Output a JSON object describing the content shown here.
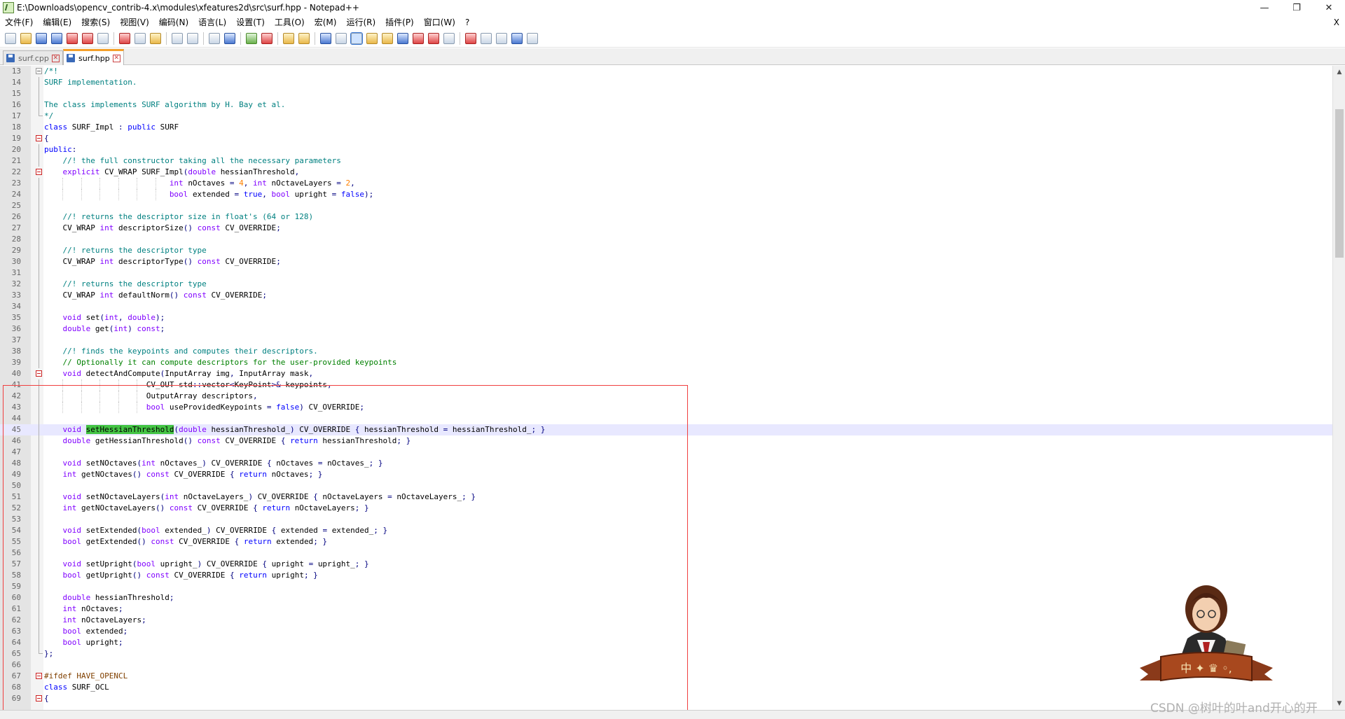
{
  "window": {
    "title": "E:\\Downloads\\opencv_contrib-4.x\\modules\\xfeatures2d\\src\\surf.hpp - Notepad++",
    "minimize": "—",
    "maximize": "❐",
    "close": "✕"
  },
  "menu": {
    "items": [
      "文件(F)",
      "编辑(E)",
      "搜索(S)",
      "视图(V)",
      "编码(N)",
      "语言(L)",
      "设置(T)",
      "工具(O)",
      "宏(M)",
      "运行(R)",
      "插件(P)",
      "窗口(W)",
      "?"
    ],
    "close_doc": "X"
  },
  "tabs": [
    {
      "label": "surf.cpp",
      "active": false
    },
    {
      "label": "surf.hpp",
      "active": true
    }
  ],
  "code": {
    "first_line": 13,
    "current_line": 45,
    "lines": [
      [
        [
          "",
          "/*!",
          "cm"
        ]
      ],
      [
        [
          "",
          "SURF implementation.",
          "cm"
        ]
      ],
      [
        [
          "",
          ""
        ]
      ],
      [
        [
          "",
          "The class implements SURF algorithm by H. Bay et al.",
          "cm"
        ]
      ],
      [
        [
          "",
          "*/",
          "cm"
        ]
      ],
      [
        [
          "",
          "class ",
          "kw"
        ],
        [
          "",
          "SURF_Impl "
        ],
        [
          "",
          ": ",
          "op"
        ],
        [
          "",
          "public ",
          "kw"
        ],
        [
          "",
          "SURF"
        ]
      ],
      [
        [
          "",
          "{",
          "op"
        ]
      ],
      [
        [
          "",
          "public",
          "kw"
        ],
        [
          "",
          ":",
          "op"
        ]
      ],
      [
        [
          "    ",
          ""
        ],
        [
          "",
          "//! the full constructor taking all the necessary parameters",
          "cm"
        ]
      ],
      [
        [
          "    ",
          ""
        ],
        [
          "",
          "explicit ",
          "kw2"
        ],
        [
          "",
          "CV_WRAP SURF_Impl"
        ],
        [
          "",
          "(",
          "op"
        ],
        [
          "",
          "double ",
          "kw2"
        ],
        [
          "",
          "hessianThreshold"
        ],
        [
          "",
          ",",
          "op"
        ]
      ],
      [
        [
          "                           ",
          ""
        ],
        [
          "",
          "int ",
          "kw2"
        ],
        [
          "",
          "nOctaves "
        ],
        [
          "",
          "= ",
          "op"
        ],
        [
          "",
          "4",
          "num"
        ],
        [
          "",
          ", ",
          "op"
        ],
        [
          "",
          "int ",
          "kw2"
        ],
        [
          "",
          "nOctaveLayers "
        ],
        [
          "",
          "= ",
          "op"
        ],
        [
          "",
          "2",
          "num"
        ],
        [
          "",
          ",",
          "op"
        ]
      ],
      [
        [
          "                           ",
          ""
        ],
        [
          "",
          "bool ",
          "kw2"
        ],
        [
          "",
          "extended "
        ],
        [
          "",
          "= ",
          "op"
        ],
        [
          "",
          "true",
          "kw"
        ],
        [
          "",
          ", ",
          "op"
        ],
        [
          "",
          "bool ",
          "kw2"
        ],
        [
          "",
          "upright "
        ],
        [
          "",
          "= ",
          "op"
        ],
        [
          "",
          "false",
          "kw"
        ],
        [
          "",
          ");",
          "op"
        ]
      ],
      [
        [
          "",
          ""
        ]
      ],
      [
        [
          "    ",
          ""
        ],
        [
          "",
          "//! returns the descriptor size in float's (64 or 128)",
          "cm"
        ]
      ],
      [
        [
          "    ",
          ""
        ],
        [
          "",
          "CV_WRAP "
        ],
        [
          "",
          "int ",
          "kw2"
        ],
        [
          "",
          "descriptorSize"
        ],
        [
          "",
          "() ",
          "op"
        ],
        [
          "",
          "const ",
          "kw2"
        ],
        [
          "",
          "CV_OVERRIDE"
        ],
        [
          "",
          ";",
          "op"
        ]
      ],
      [
        [
          "",
          ""
        ]
      ],
      [
        [
          "    ",
          ""
        ],
        [
          "",
          "//! returns the descriptor type",
          "cm"
        ]
      ],
      [
        [
          "    ",
          ""
        ],
        [
          "",
          "CV_WRAP "
        ],
        [
          "",
          "int ",
          "kw2"
        ],
        [
          "",
          "descriptorType"
        ],
        [
          "",
          "() ",
          "op"
        ],
        [
          "",
          "const ",
          "kw2"
        ],
        [
          "",
          "CV_OVERRIDE"
        ],
        [
          "",
          ";",
          "op"
        ]
      ],
      [
        [
          "",
          ""
        ]
      ],
      [
        [
          "    ",
          ""
        ],
        [
          "",
          "//! returns the descriptor type",
          "cm"
        ]
      ],
      [
        [
          "    ",
          ""
        ],
        [
          "",
          "CV_WRAP "
        ],
        [
          "",
          "int ",
          "kw2"
        ],
        [
          "",
          "defaultNorm"
        ],
        [
          "",
          "() ",
          "op"
        ],
        [
          "",
          "const ",
          "kw2"
        ],
        [
          "",
          "CV_OVERRIDE"
        ],
        [
          "",
          ";",
          "op"
        ]
      ],
      [
        [
          "",
          ""
        ]
      ],
      [
        [
          "    ",
          ""
        ],
        [
          "",
          "void ",
          "kw2"
        ],
        [
          "",
          "set"
        ],
        [
          "",
          "(",
          "op"
        ],
        [
          "",
          "int",
          "kw2"
        ],
        [
          "",
          ", ",
          "op"
        ],
        [
          "",
          "double",
          "kw2"
        ],
        [
          "",
          ");",
          "op"
        ]
      ],
      [
        [
          "    ",
          ""
        ],
        [
          "",
          "double ",
          "kw2"
        ],
        [
          "",
          "get"
        ],
        [
          "",
          "(",
          "op"
        ],
        [
          "",
          "int",
          "kw2"
        ],
        [
          "",
          ") ",
          "op"
        ],
        [
          "",
          "const",
          "kw2"
        ],
        [
          "",
          ";",
          "op"
        ]
      ],
      [
        [
          "",
          ""
        ]
      ],
      [
        [
          "    ",
          ""
        ],
        [
          "",
          "//! finds the keypoints and computes their descriptors.",
          "cm"
        ]
      ],
      [
        [
          "    ",
          ""
        ],
        [
          "",
          "// Optionally it can compute descriptors for the user-provided keypoints",
          "cm2"
        ]
      ],
      [
        [
          "    ",
          ""
        ],
        [
          "",
          "void ",
          "kw2"
        ],
        [
          "",
          "detectAndCompute"
        ],
        [
          "",
          "(",
          "op"
        ],
        [
          "",
          "InputArray img"
        ],
        [
          "",
          ", ",
          "op"
        ],
        [
          "",
          "InputArray mask"
        ],
        [
          "",
          ",",
          "op"
        ]
      ],
      [
        [
          "                      ",
          ""
        ],
        [
          "",
          "CV_OUT std"
        ],
        [
          "",
          "::",
          "op"
        ],
        [
          "",
          "vector"
        ],
        [
          "",
          "<",
          "op"
        ],
        [
          "",
          "KeyPoint"
        ],
        [
          "",
          ">& ",
          "op"
        ],
        [
          "",
          "keypoints"
        ],
        [
          "",
          ",",
          "op"
        ]
      ],
      [
        [
          "                      ",
          ""
        ],
        [
          "",
          "OutputArray descriptors"
        ],
        [
          "",
          ",",
          "op"
        ]
      ],
      [
        [
          "                      ",
          ""
        ],
        [
          "",
          "bool ",
          "kw2"
        ],
        [
          "",
          "useProvidedKeypoints "
        ],
        [
          "",
          "= ",
          "op"
        ],
        [
          "",
          "false",
          "kw"
        ],
        [
          "",
          ") ",
          "op"
        ],
        [
          "",
          "CV_OVERRIDE"
        ],
        [
          "",
          ";",
          "op"
        ]
      ],
      [
        [
          "",
          ""
        ]
      ],
      [
        [
          "    ",
          ""
        ],
        [
          "",
          "void ",
          "kw2"
        ],
        [
          "",
          "setHessianThreshold",
          "hl"
        ],
        [
          "",
          "(",
          "op"
        ],
        [
          "",
          "double ",
          "kw2"
        ],
        [
          "",
          "hessianThreshold_"
        ],
        [
          "",
          ") ",
          "op"
        ],
        [
          "",
          "CV_OVERRIDE "
        ],
        [
          "",
          "{ ",
          "op"
        ],
        [
          "",
          "hessianThreshold "
        ],
        [
          "",
          "= ",
          "op"
        ],
        [
          "",
          "hessianThreshold_"
        ],
        [
          "",
          "; }",
          "op"
        ]
      ],
      [
        [
          "    ",
          ""
        ],
        [
          "",
          "double ",
          "kw2"
        ],
        [
          "",
          "getHessianThreshold"
        ],
        [
          "",
          "() ",
          "op"
        ],
        [
          "",
          "const ",
          "kw2"
        ],
        [
          "",
          "CV_OVERRIDE "
        ],
        [
          "",
          "{ ",
          "op"
        ],
        [
          "",
          "return ",
          "kw"
        ],
        [
          "",
          "hessianThreshold"
        ],
        [
          "",
          "; }",
          "op"
        ]
      ],
      [
        [
          "",
          ""
        ]
      ],
      [
        [
          "    ",
          ""
        ],
        [
          "",
          "void ",
          "kw2"
        ],
        [
          "",
          "setNOctaves"
        ],
        [
          "",
          "(",
          "op"
        ],
        [
          "",
          "int ",
          "kw2"
        ],
        [
          "",
          "nOctaves_"
        ],
        [
          "",
          ") ",
          "op"
        ],
        [
          "",
          "CV_OVERRIDE "
        ],
        [
          "",
          "{ ",
          "op"
        ],
        [
          "",
          "nOctaves "
        ],
        [
          "",
          "= ",
          "op"
        ],
        [
          "",
          "nOctaves_"
        ],
        [
          "",
          "; }",
          "op"
        ]
      ],
      [
        [
          "    ",
          ""
        ],
        [
          "",
          "int ",
          "kw2"
        ],
        [
          "",
          "getNOctaves"
        ],
        [
          "",
          "() ",
          "op"
        ],
        [
          "",
          "const ",
          "kw2"
        ],
        [
          "",
          "CV_OVERRIDE "
        ],
        [
          "",
          "{ ",
          "op"
        ],
        [
          "",
          "return ",
          "kw"
        ],
        [
          "",
          "nOctaves"
        ],
        [
          "",
          "; }",
          "op"
        ]
      ],
      [
        [
          "",
          ""
        ]
      ],
      [
        [
          "    ",
          ""
        ],
        [
          "",
          "void ",
          "kw2"
        ],
        [
          "",
          "setNOctaveLayers"
        ],
        [
          "",
          "(",
          "op"
        ],
        [
          "",
          "int ",
          "kw2"
        ],
        [
          "",
          "nOctaveLayers_"
        ],
        [
          "",
          ") ",
          "op"
        ],
        [
          "",
          "CV_OVERRIDE "
        ],
        [
          "",
          "{ ",
          "op"
        ],
        [
          "",
          "nOctaveLayers "
        ],
        [
          "",
          "= ",
          "op"
        ],
        [
          "",
          "nOctaveLayers_"
        ],
        [
          "",
          "; }",
          "op"
        ]
      ],
      [
        [
          "    ",
          ""
        ],
        [
          "",
          "int ",
          "kw2"
        ],
        [
          "",
          "getNOctaveLayers"
        ],
        [
          "",
          "() ",
          "op"
        ],
        [
          "",
          "const ",
          "kw2"
        ],
        [
          "",
          "CV_OVERRIDE "
        ],
        [
          "",
          "{ ",
          "op"
        ],
        [
          "",
          "return ",
          "kw"
        ],
        [
          "",
          "nOctaveLayers"
        ],
        [
          "",
          "; }",
          "op"
        ]
      ],
      [
        [
          "",
          ""
        ]
      ],
      [
        [
          "    ",
          ""
        ],
        [
          "",
          "void ",
          "kw2"
        ],
        [
          "",
          "setExtended"
        ],
        [
          "",
          "(",
          "op"
        ],
        [
          "",
          "bool ",
          "kw2"
        ],
        [
          "",
          "extended_"
        ],
        [
          "",
          ") ",
          "op"
        ],
        [
          "",
          "CV_OVERRIDE "
        ],
        [
          "",
          "{ ",
          "op"
        ],
        [
          "",
          "extended "
        ],
        [
          "",
          "= ",
          "op"
        ],
        [
          "",
          "extended_"
        ],
        [
          "",
          "; }",
          "op"
        ]
      ],
      [
        [
          "    ",
          ""
        ],
        [
          "",
          "bool ",
          "kw2"
        ],
        [
          "",
          "getExtended"
        ],
        [
          "",
          "() ",
          "op"
        ],
        [
          "",
          "const ",
          "kw2"
        ],
        [
          "",
          "CV_OVERRIDE "
        ],
        [
          "",
          "{ ",
          "op"
        ],
        [
          "",
          "return ",
          "kw"
        ],
        [
          "",
          "extended"
        ],
        [
          "",
          "; }",
          "op"
        ]
      ],
      [
        [
          "",
          ""
        ]
      ],
      [
        [
          "    ",
          ""
        ],
        [
          "",
          "void ",
          "kw2"
        ],
        [
          "",
          "setUpright"
        ],
        [
          "",
          "(",
          "op"
        ],
        [
          "",
          "bool ",
          "kw2"
        ],
        [
          "",
          "upright_"
        ],
        [
          "",
          ") ",
          "op"
        ],
        [
          "",
          "CV_OVERRIDE "
        ],
        [
          "",
          "{ ",
          "op"
        ],
        [
          "",
          "upright "
        ],
        [
          "",
          "= ",
          "op"
        ],
        [
          "",
          "upright_"
        ],
        [
          "",
          "; }",
          "op"
        ]
      ],
      [
        [
          "    ",
          ""
        ],
        [
          "",
          "bool ",
          "kw2"
        ],
        [
          "",
          "getUpright"
        ],
        [
          "",
          "() ",
          "op"
        ],
        [
          "",
          "const ",
          "kw2"
        ],
        [
          "",
          "CV_OVERRIDE "
        ],
        [
          "",
          "{ ",
          "op"
        ],
        [
          "",
          "return ",
          "kw"
        ],
        [
          "",
          "upright"
        ],
        [
          "",
          "; }",
          "op"
        ]
      ],
      [
        [
          "",
          ""
        ]
      ],
      [
        [
          "    ",
          ""
        ],
        [
          "",
          "double ",
          "kw2"
        ],
        [
          "",
          "hessianThreshold"
        ],
        [
          "",
          ";",
          "op"
        ]
      ],
      [
        [
          "    ",
          ""
        ],
        [
          "",
          "int ",
          "kw2"
        ],
        [
          "",
          "nOctaves"
        ],
        [
          "",
          ";",
          "op"
        ]
      ],
      [
        [
          "    ",
          ""
        ],
        [
          "",
          "int ",
          "kw2"
        ],
        [
          "",
          "nOctaveLayers"
        ],
        [
          "",
          ";",
          "op"
        ]
      ],
      [
        [
          "    ",
          ""
        ],
        [
          "",
          "bool ",
          "kw2"
        ],
        [
          "",
          "extended"
        ],
        [
          "",
          ";",
          "op"
        ]
      ],
      [
        [
          "    ",
          ""
        ],
        [
          "",
          "bool ",
          "kw2"
        ],
        [
          "",
          "upright"
        ],
        [
          "",
          ";",
          "op"
        ]
      ],
      [
        [
          "",
          "};",
          "op"
        ]
      ],
      [
        [
          "",
          ""
        ]
      ],
      [
        [
          "",
          "#ifdef ",
          "pp"
        ],
        [
          "",
          "HAVE_OPENCL",
          "pp"
        ]
      ],
      [
        [
          "",
          "class ",
          "kw"
        ],
        [
          "",
          "SURF_OCL"
        ]
      ],
      [
        [
          "",
          "{",
          "op"
        ]
      ]
    ],
    "folds": {
      "13": "box",
      "19": "box",
      "22": "box",
      "40": "box",
      "67": "box",
      "69": "box"
    }
  },
  "watermark": "CSDN @树叶的叶and开心的开",
  "colors": {
    "keyword": "#0000ff",
    "type": "#8000ff",
    "comment": "#008080",
    "number": "#ff8000",
    "highlight": "#44c444",
    "current_line": "#e8e8ff",
    "annotation_box": "#f04040",
    "tab_accent": "#f4a02a"
  }
}
